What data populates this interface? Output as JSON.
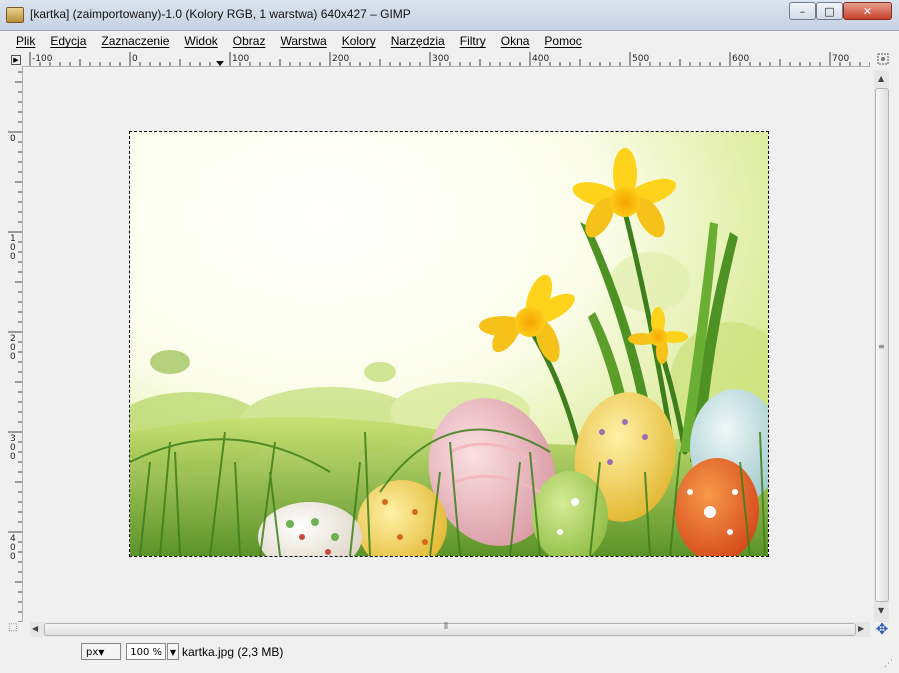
{
  "window": {
    "title": "[kartka] (zaimportowany)-1.0 (Kolory RGB, 1 warstwa) 640x427 – GIMP",
    "minimize": "–",
    "maximize": "□",
    "close": "✕"
  },
  "menu": [
    {
      "label": "Plik"
    },
    {
      "label": "Edycja"
    },
    {
      "label": "Zaznaczenie"
    },
    {
      "label": "Widok"
    },
    {
      "label": "Obraz"
    },
    {
      "label": "Warstwa"
    },
    {
      "label": "Kolory"
    },
    {
      "label": "Narzędzia"
    },
    {
      "label": "Filtry"
    },
    {
      "label": "Okna"
    },
    {
      "label": "Pomoc"
    }
  ],
  "rulers": {
    "horizontal_labels": [
      "-100",
      "0",
      "100",
      "200",
      "300",
      "400",
      "500",
      "600",
      "700"
    ],
    "vertical_labels": [
      "0",
      "100",
      "200",
      "300",
      "400"
    ]
  },
  "image": {
    "description_icons": [
      "daffodil-icon",
      "easter-egg-icon",
      "grass-icon"
    ]
  },
  "statusbar": {
    "unit": "px",
    "zoom": "100 %",
    "info": "kartka.jpg (2,3 MB)"
  },
  "colors": {
    "titlebar": "#c6d3e3",
    "background": "#f0f0f0",
    "selection": "#000000",
    "navigate_icon": "#2a5db0"
  }
}
